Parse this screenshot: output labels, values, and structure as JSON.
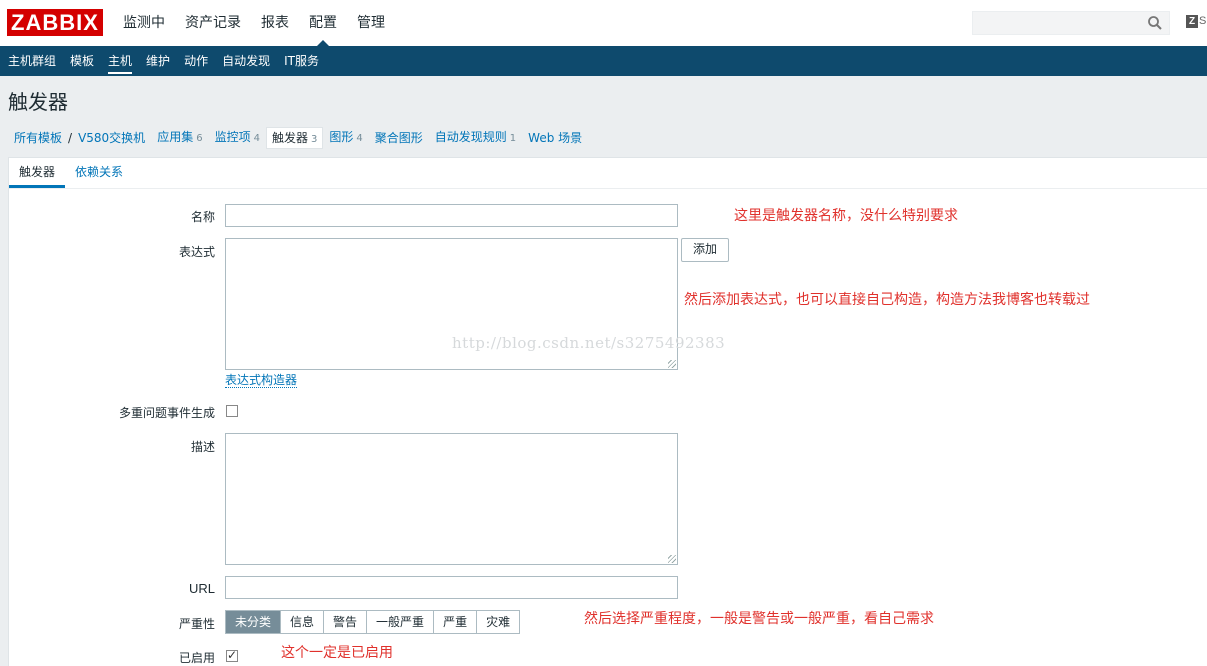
{
  "logo": "ZABBIX",
  "top_menu": [
    "监测中",
    "资产记录",
    "报表",
    "配置",
    "管理"
  ],
  "share_label": "S",
  "sub_menu": [
    "主机群组",
    "模板",
    "主机",
    "维护",
    "动作",
    "自动发现",
    "IT服务"
  ],
  "page_title": "触发器",
  "breadcrumbs": {
    "all_templates": "所有模板",
    "separator": "/",
    "host": "V580交换机",
    "items": [
      {
        "label": "应用集",
        "count": "6"
      },
      {
        "label": "监控项",
        "count": "4"
      },
      {
        "label": "触发器",
        "count": "3"
      },
      {
        "label": "图形",
        "count": "4"
      },
      {
        "label": "聚合图形",
        "count": ""
      },
      {
        "label": "自动发现规则",
        "count": "1"
      },
      {
        "label": "Web 场景",
        "count": ""
      }
    ]
  },
  "tabs": [
    "触发器",
    "依赖关系"
  ],
  "form": {
    "name_label": "名称",
    "name_value": "",
    "expression_label": "表达式",
    "expression_value": "",
    "add_button": "添加",
    "expression_builder_link": "表达式构造器",
    "multiple_events_label": "多重问题事件生成",
    "description_label": "描述",
    "description_value": "",
    "url_label": "URL",
    "url_value": "",
    "severity_label": "严重性",
    "severity_options": [
      "未分类",
      "信息",
      "警告",
      "一般严重",
      "严重",
      "灾难"
    ],
    "severity_selected": "未分类",
    "enabled_label": "已启用",
    "enabled_checked": true,
    "multiple_events_checked": false
  },
  "annotations": {
    "name_note": "这里是触发器名称，没什么特别要求",
    "expression_note": "然后添加表达式，也可以直接自己构造，构造方法我博客也转载过",
    "severity_note": "然后选择严重程度，一般是警告或一般严重，看自己需求",
    "enabled_note": "这个一定是已启用"
  },
  "watermark": "http://blog.csdn.net/s3275492383",
  "colors": {
    "brand_red": "#d40000",
    "nav_blue": "#0e4a6d",
    "link_blue": "#0275b8",
    "note_red": "#e0312c",
    "severity_active": "#768d99"
  }
}
